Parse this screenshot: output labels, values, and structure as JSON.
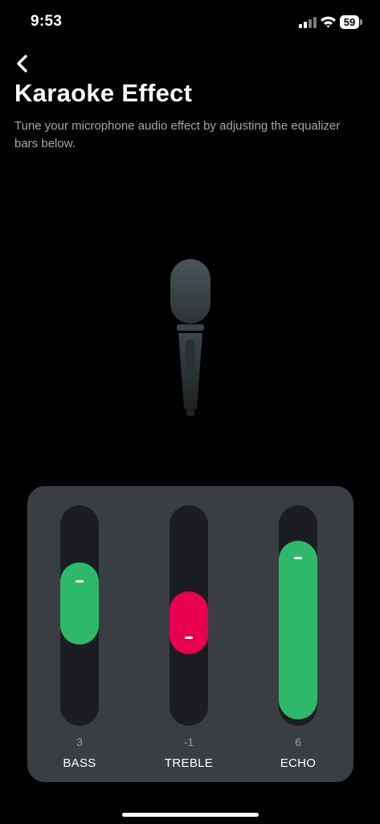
{
  "status_bar": {
    "time": "9:53",
    "battery_level": "59",
    "icons": [
      "signal-icon",
      "wifi-icon",
      "battery-icon"
    ]
  },
  "header": {
    "back_icon": "chevron-left-icon",
    "title": "Karaoke Effect",
    "subtitle": "Tune your microphone audio effect by adjusting the equalizer bars below."
  },
  "illustration": {
    "icon": "microphone-icon"
  },
  "equalizer": {
    "range": [
      -10,
      10
    ],
    "sliders": [
      {
        "key": "bass",
        "label": "BASS",
        "value": "3",
        "level": 3,
        "color": "#2db86a"
      },
      {
        "key": "treble",
        "label": "TREBLE",
        "value": "-1",
        "level": -1,
        "color": "#e8004f"
      },
      {
        "key": "echo",
        "label": "ECHO",
        "value": "6",
        "level": 6,
        "color": "#2db86a"
      }
    ]
  },
  "colors": {
    "background": "#000000",
    "panel": "#3a3d42",
    "track": "#1b1d21",
    "positive": "#2db86a",
    "negative": "#e8004f",
    "subtitle_text": "#a7a7ab"
  }
}
